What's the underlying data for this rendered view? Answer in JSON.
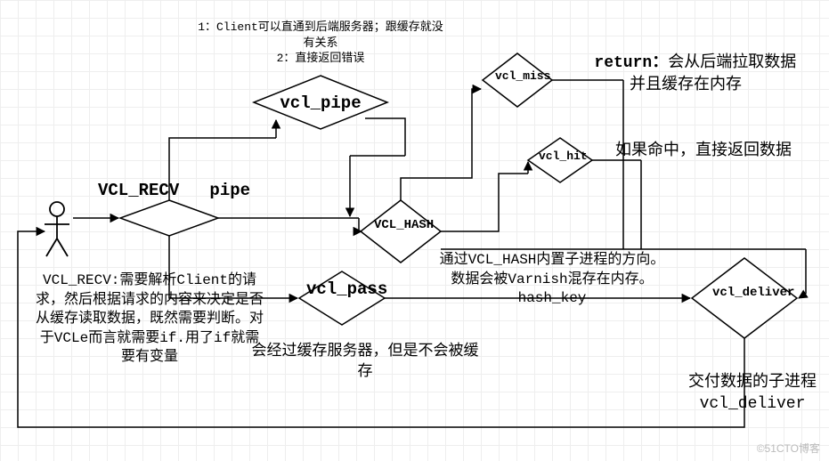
{
  "chart_data": {
    "type": "flowchart",
    "nodes": [
      {
        "id": "user",
        "type": "actor",
        "label": ""
      },
      {
        "id": "vcl_recv",
        "type": "decision",
        "label": "VCL_RECV   pipe"
      },
      {
        "id": "vcl_pipe",
        "type": "decision",
        "label": "vcl_pipe"
      },
      {
        "id": "vcl_hash",
        "type": "decision",
        "label": "VCL_HASH"
      },
      {
        "id": "vcl_pass",
        "type": "decision",
        "label": "vcl_pass"
      },
      {
        "id": "vcl_miss",
        "type": "decision",
        "label": "vcl_miss"
      },
      {
        "id": "vcl_hit",
        "type": "decision",
        "label": "vcl_hit"
      },
      {
        "id": "vcl_deliver",
        "type": "decision",
        "label": "vcl_deliver"
      }
    ],
    "edges": [
      {
        "from": "user",
        "to": "vcl_recv"
      },
      {
        "from": "vcl_recv",
        "to": "vcl_pipe"
      },
      {
        "from": "vcl_recv",
        "to": "vcl_hash"
      },
      {
        "from": "vcl_recv",
        "to": "vcl_pass"
      },
      {
        "from": "vcl_hash",
        "to": "vcl_miss"
      },
      {
        "from": "vcl_hash",
        "to": "vcl_hit"
      },
      {
        "from": "vcl_pass",
        "to": "vcl_deliver"
      },
      {
        "from": "vcl_hit",
        "to": "vcl_deliver"
      },
      {
        "from": "vcl_miss",
        "to": "vcl_deliver"
      },
      {
        "from": "vcl_deliver",
        "to": "user"
      }
    ]
  },
  "notes": {
    "pipe_note": "1：Client可以直通到后端服务器；跟缓存就没有关系\n2：直接返回错误",
    "return_note_label": "return：",
    "return_note_body": "会从后端拉取数据并且缓存在内存",
    "hit_note": "如果命中，直接返回数据",
    "hash_note": "通过VCL_HASH内置子进程的方向。数据会被Varnish混存在内存。hash_key",
    "pass_note": "会经过缓存服务器，但是不会被缓存",
    "recv_note": "VCL_RECV:需要解析Client的请求，然后根据请求的内容来决定是否从缓存读取数据，既然需要判断。对于VCLe而言就需要if.用了if就需要有变量",
    "deliver_note": "交付数据的子进程 vcl_deliver"
  },
  "labels": {
    "vcl_recv": "VCL_RECV   pipe",
    "vcl_pipe": "vcl_pipe",
    "vcl_hash": "VCL_HASH",
    "vcl_pass": "vcl_pass",
    "vcl_miss": "vcl_miss",
    "vcl_hit": "vcl_hit",
    "vcl_deliver": "vcl_deliver"
  },
  "watermark": "©51CTO博客"
}
